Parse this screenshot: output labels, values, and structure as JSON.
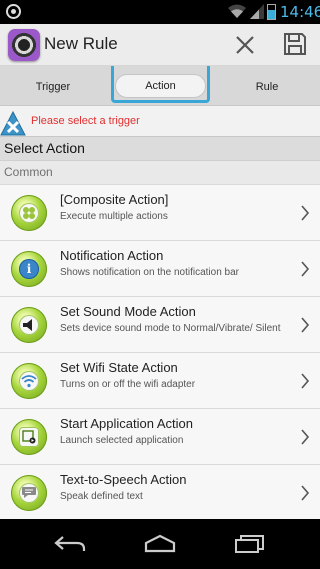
{
  "status_bar": {
    "time": "14:46"
  },
  "header": {
    "title": "New Rule"
  },
  "tabs": [
    {
      "label": "Trigger"
    },
    {
      "label": "Action"
    },
    {
      "label": "Rule"
    }
  ],
  "error": {
    "message": "Please select a trigger"
  },
  "section": {
    "title": "Select Action",
    "group": "Common"
  },
  "actions": [
    {
      "name": "[Composite Action]",
      "description": "Execute multiple actions",
      "icon": "composite-icon"
    },
    {
      "name": "Notification Action",
      "description": "Shows notification on the notification bar",
      "icon": "info-icon"
    },
    {
      "name": "Set Sound Mode Action",
      "description": "Sets device sound mode to Normal/Vibrate/ Silent",
      "icon": "speaker-icon"
    },
    {
      "name": "Set Wifi State Action",
      "description": "Turns on or off the wifi adapter",
      "icon": "wifi-icon"
    },
    {
      "name": "Start Application Action",
      "description": "Launch selected application",
      "icon": "app-launch-icon"
    },
    {
      "name": "Text-to-Speech Action",
      "description": "Speak defined text",
      "icon": "speech-bubble-icon"
    }
  ],
  "colors": {
    "accent": "#3aa6d8",
    "error": "#e03030",
    "icon_green": "#a8d63d"
  }
}
